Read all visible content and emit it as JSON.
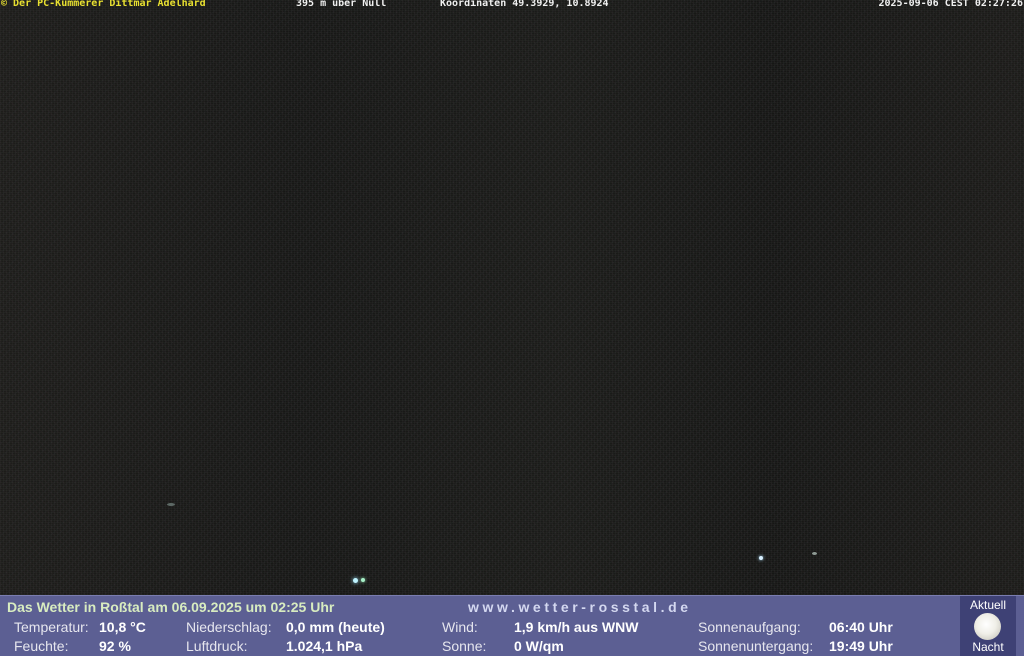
{
  "overlay": {
    "copyright": "© Der PC-Kümmerer Dittmar Adelhard",
    "altitude": "395 m über Null",
    "coordinates": "Koordinaten 49.3929, 10.8924",
    "timestamp": "2025-09-06 CEST 02:27:26"
  },
  "weather": {
    "title": "Das Wetter in Roßtal am 06.09.2025 um 02:25 Uhr",
    "url": "www.wetter-rosstal.de",
    "temperature_label": "Temperatur:",
    "temperature_value": "10,8 °C",
    "humidity_label": "Feuchte:",
    "humidity_value": "92 %",
    "precip_label": "Niederschlag:",
    "precip_value": "0,0 mm (heute)",
    "pressure_label": "Luftdruck:",
    "pressure_value": "1.024,1 hPa",
    "wind_label": "Wind:",
    "wind_value": "1,9 km/h aus WNW",
    "sun_label": "Sonne:",
    "sun_value": "0 W/qm",
    "sunrise_label": "Sonnenaufgang:",
    "sunrise_value": "06:40 Uhr",
    "sunset_label": "Sonnenuntergang:",
    "sunset_value": "19:49 Uhr"
  },
  "moon": {
    "top_label": "Aktuell",
    "bottom_label": "Nacht",
    "icon": "full-moon-icon"
  },
  "colors": {
    "overlay_highlight": "#e8e030",
    "weather_bar": "#5c5f93",
    "moon_box": "#3e4175"
  }
}
